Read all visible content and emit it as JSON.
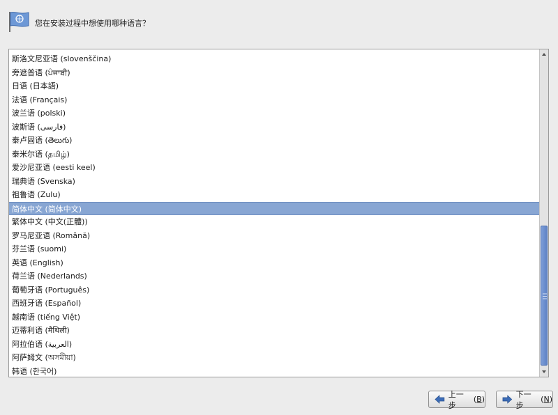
{
  "header": {
    "question": "您在安装过程中想使用哪种语言？"
  },
  "language_list": {
    "items": [
      "斯洛文尼亚语 (slovenščina)",
      "旁遮普语 (ਪੰਜਾਬੀ)",
      "日语 (日本語)",
      "法语 (Français)",
      "波兰语 (polski)",
      "波斯语 (فارسی)",
      "泰卢固语 (తెలుగు)",
      "泰米尔语 (தமிழ்)",
      "爱沙尼亚语 (eesti keel)",
      "瑞典语 (Svenska)",
      "祖鲁语 (Zulu)",
      "简体中文 (简体中文)",
      "繁体中文 (中文(正體))",
      "罗马尼亚语 (Română)",
      "芬兰语 (suomi)",
      "英语 (English)",
      "荷兰语 (Nederlands)",
      "葡萄牙语 (Português)",
      "西班牙语 (Español)",
      "越南语 (tiếng Việt)",
      "迈蒂利语 (मैथिली)",
      "阿拉伯语 (العربية)",
      "阿萨姆文 (অসমীয়া)",
      "韩语 (한국어)"
    ],
    "selected_index": 11
  },
  "buttons": {
    "back": {
      "label": "上一步",
      "key": "B"
    },
    "next": {
      "label": "下一步",
      "key": "N"
    }
  },
  "colors": {
    "selection": "#88a6d3",
    "scroll_thumb": "#6f90cf",
    "arrow_blue": "#3d6db8"
  }
}
